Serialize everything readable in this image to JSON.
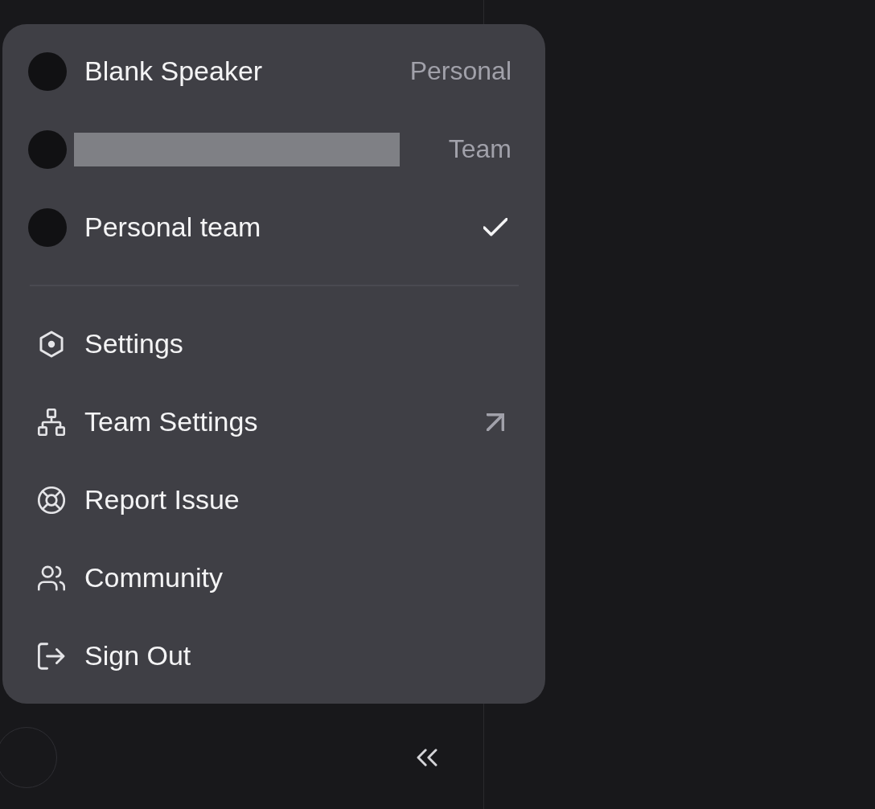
{
  "account_menu": {
    "accounts": [
      {
        "name": "Blank Speaker",
        "redacted": false,
        "badge": "Personal",
        "selected": false
      },
      {
        "redacted": true,
        "badge": "Team",
        "selected": false
      },
      {
        "name": "Personal team",
        "redacted": false,
        "selected": true
      }
    ],
    "items": [
      {
        "kind": "settings",
        "label": "Settings",
        "external": false
      },
      {
        "kind": "team",
        "label": "Team Settings",
        "external": true
      },
      {
        "kind": "support",
        "label": "Report Issue",
        "external": false
      },
      {
        "kind": "community",
        "label": "Community",
        "external": false
      },
      {
        "kind": "sign_out",
        "label": "Sign Out",
        "external": false
      }
    ]
  }
}
